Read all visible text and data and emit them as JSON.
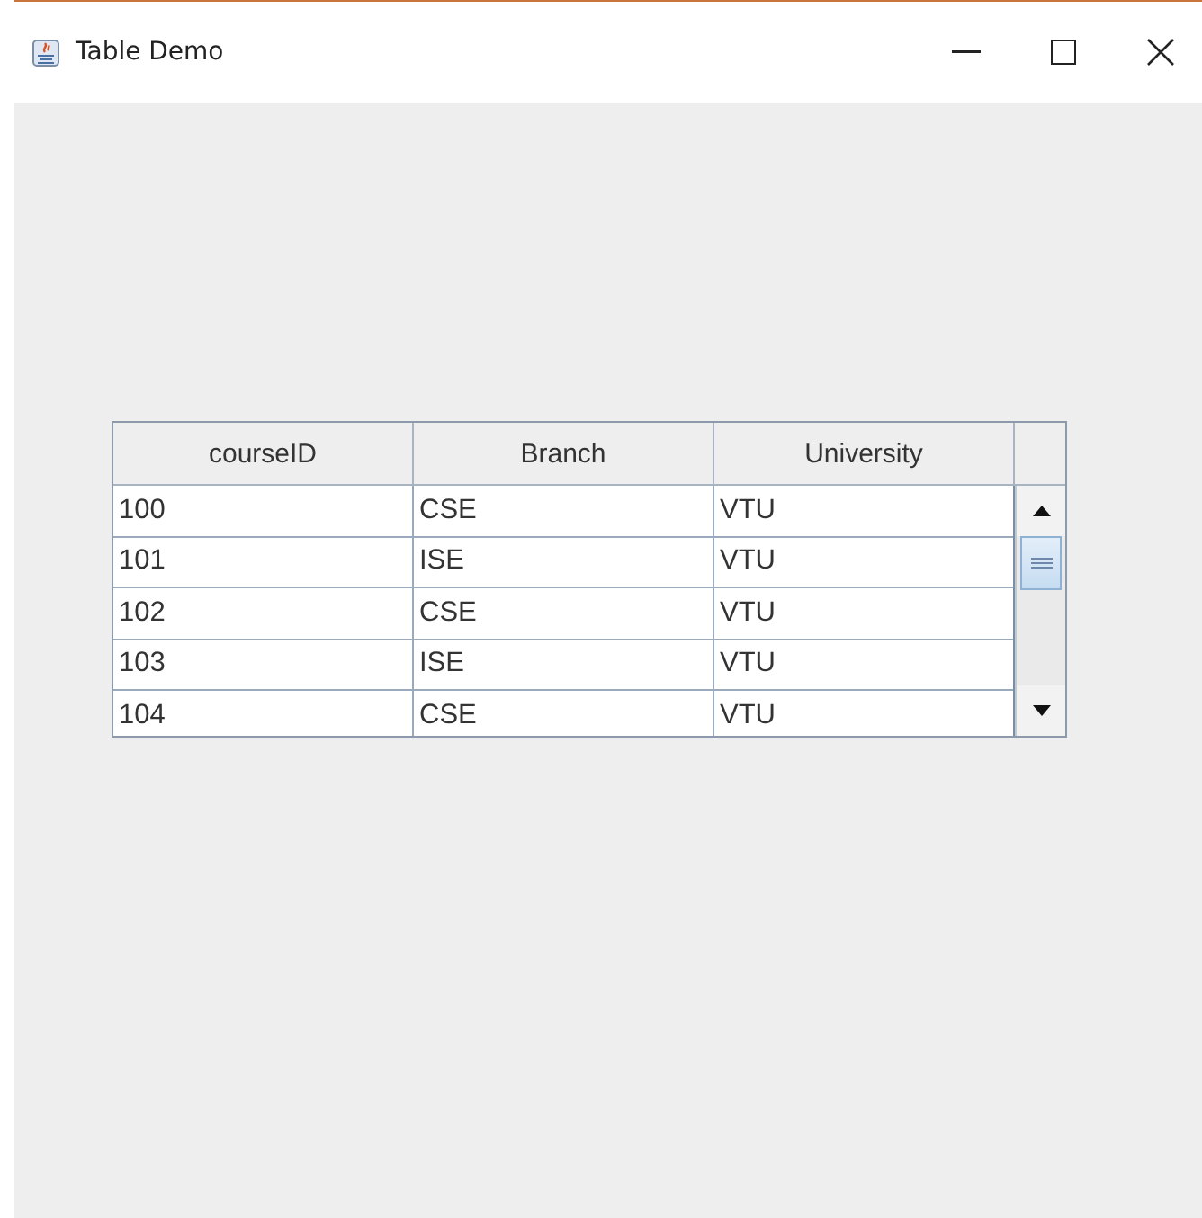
{
  "window": {
    "title": "Table Demo"
  },
  "table": {
    "columns": [
      "courseID",
      "Branch",
      "University"
    ],
    "rows": [
      [
        "100",
        "CSE",
        "VTU"
      ],
      [
        "101",
        "ISE",
        "VTU"
      ],
      [
        "102",
        "CSE",
        "VTU"
      ],
      [
        "103",
        "ISE",
        "VTU"
      ],
      [
        "104",
        "CSE",
        "VTU"
      ]
    ]
  }
}
